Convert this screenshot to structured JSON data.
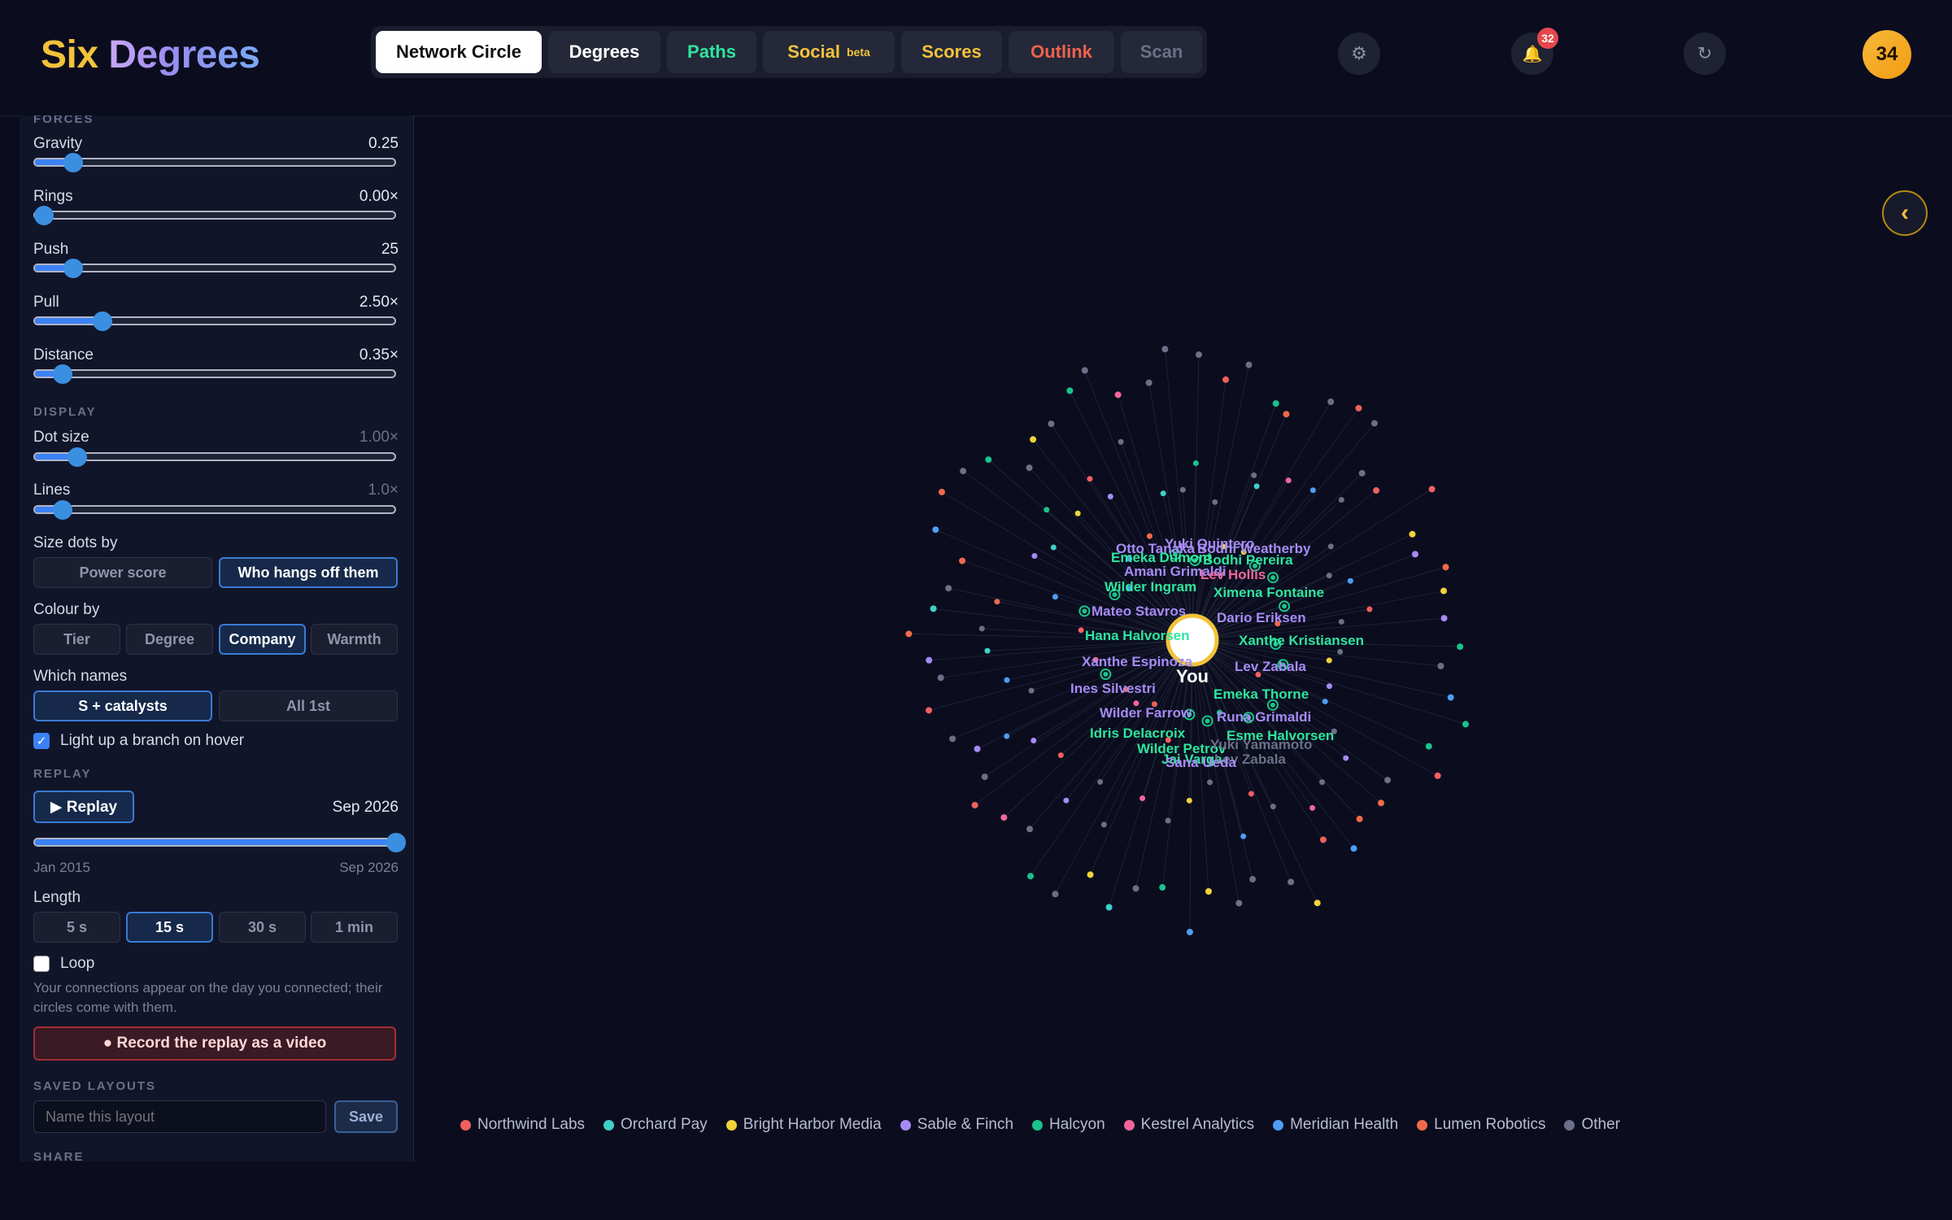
{
  "app": {
    "brand_part1": "Six",
    "brand_part2": "Degrees"
  },
  "nav": {
    "tabs": [
      {
        "label": "Network Circle",
        "color": "#111111",
        "active": true
      },
      {
        "label": "Degrees",
        "color": "#ffffff"
      },
      {
        "label": "Paths",
        "color": "#2ee59d"
      },
      {
        "label": "Social",
        "color": "#f2c23a",
        "badge": "beta"
      },
      {
        "label": "Scores",
        "color": "#f2c23a"
      },
      {
        "label": "Outlink",
        "color": "#f0624d"
      },
      {
        "label": "Scan",
        "color": "#6b7088"
      }
    ],
    "settings_icon": "gear-icon",
    "notifications": {
      "icon": "bell-icon",
      "count": "32"
    },
    "refresh_icon": "refresh-icon",
    "avatar_text": "34"
  },
  "panel": {
    "forces_title": "FORCES",
    "sliders": [
      {
        "label": "Gravity",
        "value": "0.25",
        "level": 0.11
      },
      {
        "label": "Rings",
        "value": "0.00×",
        "level": 0.03
      },
      {
        "label": "Push",
        "value": "25",
        "level": 0.11
      },
      {
        "label": "Pull",
        "value": "2.50×",
        "level": 0.19
      },
      {
        "label": "Distance",
        "value": "0.35×",
        "level": 0.08
      }
    ],
    "display_title": "DISPLAY",
    "display_sliders": [
      {
        "label": "Dot size",
        "value": "1.00×",
        "level": 0.12
      },
      {
        "label": "Lines",
        "value": "1.0×",
        "level": 0.08
      }
    ],
    "size_by": {
      "label": "Size dots by",
      "options": [
        "Power score",
        "Who hangs off them"
      ],
      "selected": "Who hangs off them"
    },
    "colour_by": {
      "label": "Colour by",
      "options": [
        "Tier",
        "Degree",
        "Company",
        "Warmth"
      ],
      "selected": "Company"
    },
    "which_names": {
      "label": "Which names",
      "options": [
        "S + catalysts",
        "All 1st"
      ],
      "selected": "S + catalysts"
    },
    "hover_branch": {
      "label": "Light up a branch on hover",
      "checked": true
    },
    "replay": {
      "title": "REPLAY",
      "button": "▶ Replay",
      "current": "Sep 2026",
      "start": "Jan 2015",
      "end": "Sep 2026",
      "progress": 1.0,
      "length_label": "Length",
      "length_options": [
        "5 s",
        "15 s",
        "30 s",
        "1 min"
      ],
      "length_selected": "15 s",
      "loop": {
        "label": "Loop",
        "checked": false
      },
      "note": "Your connections appear on the day you connected; their circles come with them.",
      "record": "● Record the replay as a video"
    },
    "saved_layouts": {
      "title": "SAVED LAYOUTS",
      "placeholder": "Name this layout",
      "save": "Save"
    },
    "share_title": "SHARE"
  },
  "graph": {
    "center_label": "You",
    "collapse_icon": "chevron-left-icon",
    "collapse_glyph": "‹",
    "names": [
      {
        "t": "Otto Tanaka",
        "c": "#a68bf5"
      },
      {
        "t": "Yuki Quintero",
        "c": "#a68bf5"
      },
      {
        "t": "Bodhi Weatherby",
        "c": "#a68bf5"
      },
      {
        "t": "Emeka Dumont",
        "c": "#2ee59d"
      },
      {
        "t": "Bodhi Pereira",
        "c": "#2ee59d"
      },
      {
        "t": "Amani Grimaldi",
        "c": "#a68bf5"
      },
      {
        "t": "Lev Hollis",
        "c": "#f0669a"
      },
      {
        "t": "Wilder Ingram",
        "c": "#2ee59d"
      },
      {
        "t": "Ximena Fontaine",
        "c": "#2ee59d"
      },
      {
        "t": "Mateo Stavros",
        "c": "#a68bf5"
      },
      {
        "t": "Dario Eriksen",
        "c": "#a68bf5"
      },
      {
        "t": "Hana Halvorsen",
        "c": "#2ee59d"
      },
      {
        "t": "Xanthe Kristiansen",
        "c": "#2ee59d"
      },
      {
        "t": "Xanthe Espinoza",
        "c": "#a68bf5"
      },
      {
        "t": "Lev Zabala",
        "c": "#a68bf5"
      },
      {
        "t": "Ines Silvestri",
        "c": "#a68bf5"
      },
      {
        "t": "Emeka Thorne",
        "c": "#2ee59d"
      },
      {
        "t": "Wilder Farrow",
        "c": "#a68bf5"
      },
      {
        "t": "Runa Grimaldi",
        "c": "#a68bf5"
      },
      {
        "t": "Idris Delacroix",
        "c": "#2ee59d"
      },
      {
        "t": "Esme Halvorsen",
        "c": "#2ee59d"
      },
      {
        "t": "Wilder Petrov",
        "c": "#2ee59d"
      },
      {
        "t": "Yuki Yamamoto",
        "c": "#6b7088"
      },
      {
        "t": "Jai Varga",
        "c": "#2ee59d"
      },
      {
        "t": "Lev Zabala",
        "c": "#6b7088"
      },
      {
        "t": "Sana Ueda",
        "c": "#a68bf5"
      }
    ]
  },
  "legend": [
    {
      "label": "Northwind Labs",
      "color": "#f06060"
    },
    {
      "label": "Orchard Pay",
      "color": "#3fd0c9"
    },
    {
      "label": "Bright Harbor Media",
      "color": "#f2d33a"
    },
    {
      "label": "Sable & Finch",
      "color": "#a68bf5"
    },
    {
      "label": "Halcyon",
      "color": "#19c48b"
    },
    {
      "label": "Kestrel Analytics",
      "color": "#f0669a"
    },
    {
      "label": "Meridian Health",
      "color": "#4f9df5"
    },
    {
      "label": "Lumen Robotics",
      "color": "#f06a4a"
    },
    {
      "label": "Other",
      "color": "#6b7088"
    }
  ]
}
